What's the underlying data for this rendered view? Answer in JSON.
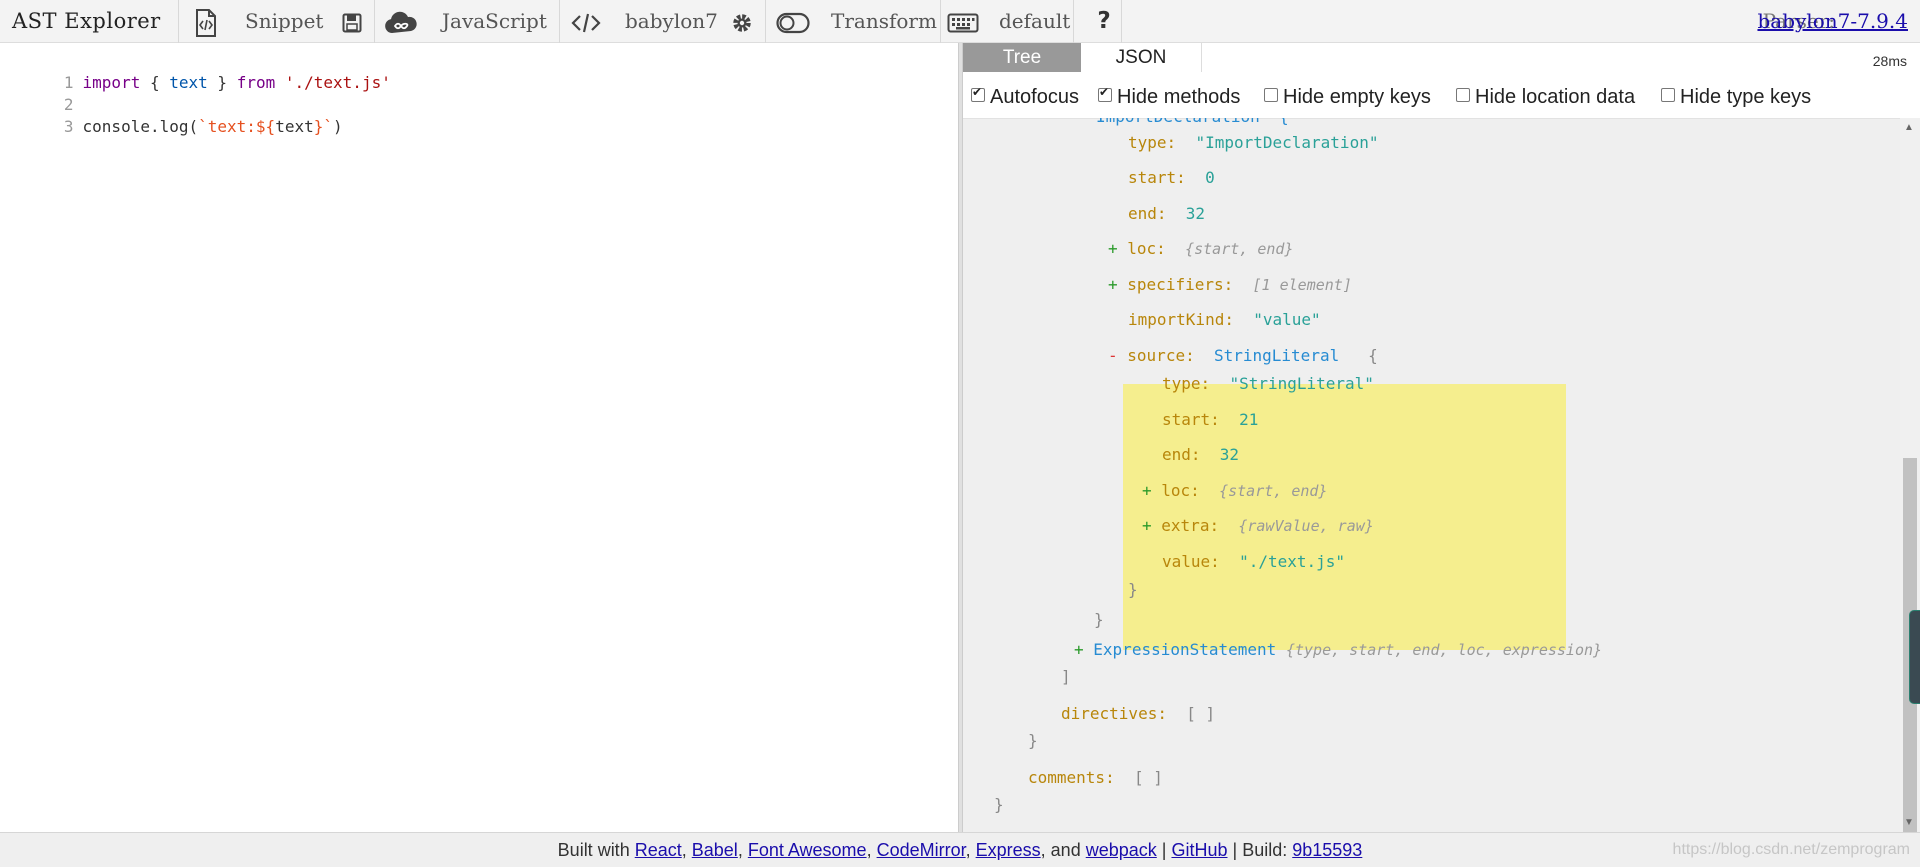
{
  "toolbar": {
    "app_title": "AST Explorer",
    "snippet_label": "Snippet",
    "language_label": "JavaScript",
    "parser_label": "babylon7",
    "transform_label": "Transform",
    "keymap_label": "default",
    "parser_prefix": "Parser:",
    "parser_version": "babylon7-7.9.4"
  },
  "editor": {
    "lines": [
      {
        "num": "1"
      },
      {
        "num": "2"
      },
      {
        "num": "3"
      }
    ],
    "tokens": {
      "import_kw": "import",
      "brace_open": "{",
      "text_var": "text",
      "brace_close": "}",
      "from_kw": "from",
      "path_str": "'./text.js'",
      "console_log": "console.log(",
      "tmpl_start": "`text:${",
      "tmpl_var": "text",
      "tmpl_end": "}`",
      "paren_close": ")"
    }
  },
  "output": {
    "tabs": [
      "Tree",
      "JSON"
    ],
    "time": "28ms",
    "options": [
      {
        "label": "Autofocus",
        "checked": true
      },
      {
        "label": "Hide methods",
        "checked": true
      },
      {
        "label": "Hide empty keys",
        "checked": false
      },
      {
        "label": "Hide location data",
        "checked": false
      },
      {
        "label": "Hide type keys",
        "checked": false
      }
    ],
    "tree": {
      "partial_top": "ImportDeclaration  {",
      "type_k": "type:",
      "type_v": "\"ImportDeclaration\"",
      "start_k": "start:",
      "start_v": "0",
      "end_k": "end:",
      "end_v": "32",
      "loc_k": "loc:",
      "loc_sum": "{start, end}",
      "spec_k": "specifiers:",
      "spec_sum": "[1 element]",
      "ik_k": "importKind:",
      "ik_v": "\"value\"",
      "source_k": "source:",
      "source_t": "StringLiteral",
      "source_b": "{",
      "s_type_k": "type:",
      "s_type_v": "\"StringLiteral\"",
      "s_start_k": "start:",
      "s_start_v": "21",
      "s_end_k": "end:",
      "s_end_v": "32",
      "s_loc_k": "loc:",
      "s_loc_sum": "{start, end}",
      "s_extra_k": "extra:",
      "s_extra_sum": "{rawValue, raw}",
      "s_value_k": "value:",
      "s_value_v": "\"./text.js\"",
      "close_brace": "}",
      "es_t": "ExpressionStatement",
      "es_sum": "{type, start, end, loc, expression}",
      "close_bracket": "]",
      "dir_k": "directives:",
      "empty_arr": "[ ]",
      "com_k": "comments:",
      "plus": "+",
      "minus": "-"
    }
  },
  "footer": {
    "built_with": "Built with",
    "links": [
      "React",
      "Babel",
      "Font Awesome",
      "CodeMirror",
      "Express",
      "webpack"
    ],
    "and": "and",
    "github": "GitHub",
    "build_label": "Build:",
    "build_hash": "9b15593",
    "watermark": "https://blog.csdn.net/zemprogram"
  }
}
